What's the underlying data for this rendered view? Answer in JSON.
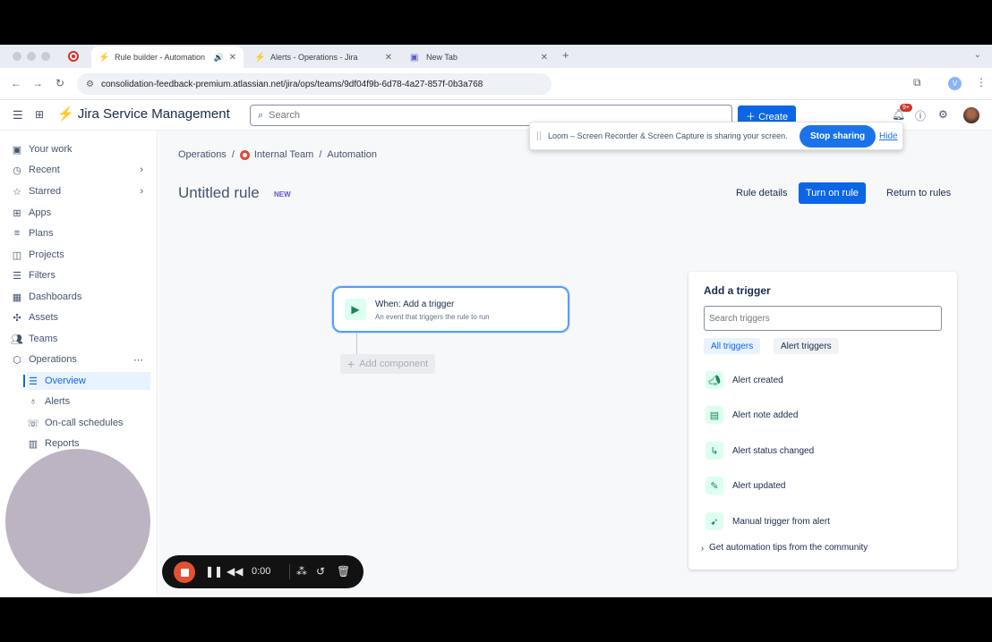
{
  "browser": {
    "tabs": [
      {
        "title": "Rule builder - Automation",
        "active": true
      },
      {
        "title": "Alerts - Operations - Jira",
        "active": false
      },
      {
        "title": "New Tab",
        "active": false
      }
    ],
    "url": "consolidation-feedback-premium.atlassian.net/jira/ops/teams/9df04f9b-6d78-4a27-857f-0b3a768",
    "profile_initial": "V"
  },
  "loom": {
    "message": "Loom – Screen Recorder & Screen Capture is sharing your screen.",
    "stop_label": "Stop sharing",
    "hide_label": "Hide"
  },
  "topnav": {
    "brand": "Jira Service Management",
    "search_placeholder": "Search",
    "create_label": "Create",
    "notif_count": "9+"
  },
  "sidebar": {
    "items": [
      {
        "label": "Your work"
      },
      {
        "label": "Recent"
      },
      {
        "label": "Starred"
      },
      {
        "label": "Apps"
      },
      {
        "label": "Plans"
      },
      {
        "label": "Projects"
      },
      {
        "label": "Filters"
      },
      {
        "label": "Dashboards"
      },
      {
        "label": "Assets"
      },
      {
        "label": "Teams"
      },
      {
        "label": "Operations"
      }
    ],
    "sub_items": [
      {
        "label": "Overview"
      },
      {
        "label": "Alerts"
      },
      {
        "label": "On-call schedules"
      },
      {
        "label": "Reports"
      }
    ]
  },
  "breadcrumbs": [
    "Operations",
    "Internal Team",
    "Automation"
  ],
  "rule": {
    "title": "Untitled rule",
    "badge": "NEW",
    "details_label": "Rule details",
    "turn_on_label": "Turn on rule",
    "return_label": "Return to rules"
  },
  "canvas": {
    "trigger_title": "When: Add a trigger",
    "trigger_sub": "An event that triggers the rule to run",
    "add_component_label": "Add component"
  },
  "panel": {
    "title": "Add a trigger",
    "search_placeholder": "Search triggers",
    "filter_all": "All triggers",
    "filter_alert": "Alert triggers",
    "options": [
      {
        "label": "Alert created",
        "icon": "megaphone-icon"
      },
      {
        "label": "Alert note added",
        "icon": "note-icon"
      },
      {
        "label": "Alert status changed",
        "icon": "status-flow-icon"
      },
      {
        "label": "Alert updated",
        "icon": "pencil-icon"
      },
      {
        "label": "Manual trigger from alert",
        "icon": "cursor-click-icon"
      }
    ],
    "tips_label": "Get automation tips from the community"
  },
  "recorder": {
    "time": "0:00"
  }
}
